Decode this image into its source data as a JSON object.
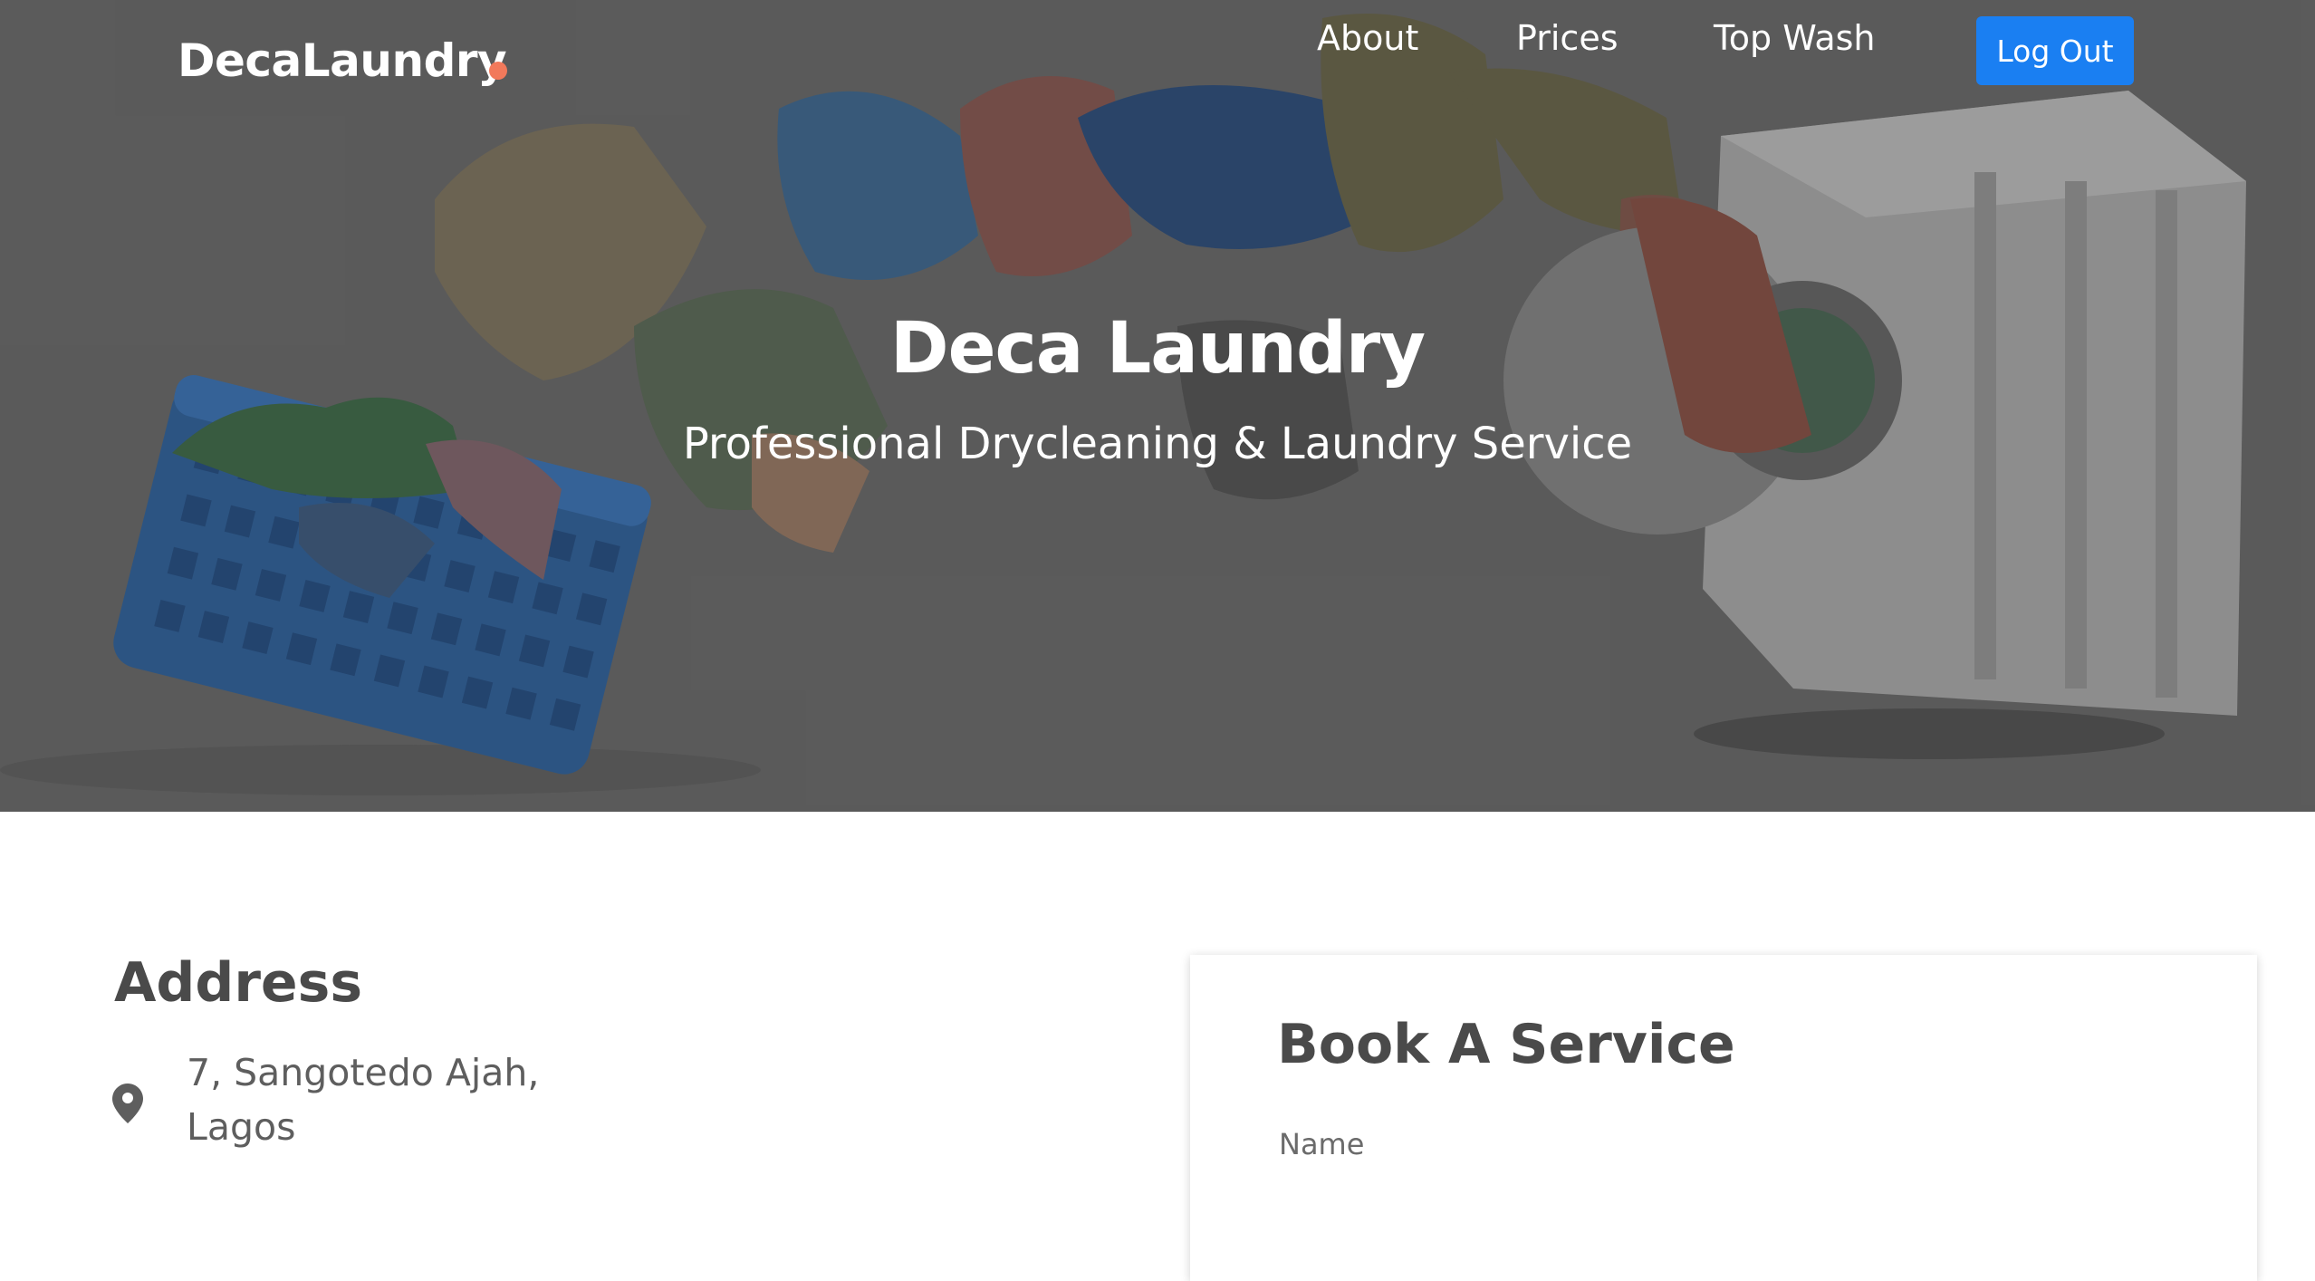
{
  "nav": {
    "brand": "DecaLaundry",
    "links": [
      {
        "label": "About"
      },
      {
        "label": "Prices"
      },
      {
        "label": "Top Wash"
      }
    ],
    "logout_label": "Log Out"
  },
  "hero": {
    "title": "Deca Laundry",
    "subtitle": "Professional Drycleaning & Laundry Service"
  },
  "address": {
    "heading": "Address",
    "line1": "7, Sangotedo Ajah,",
    "line2": "Lagos",
    "icon": "map-pin-icon"
  },
  "booking": {
    "title": "Book A Service",
    "name_label": "Name"
  },
  "colors": {
    "brand_dot": "#f2795b",
    "button": "#1a7ff2"
  }
}
